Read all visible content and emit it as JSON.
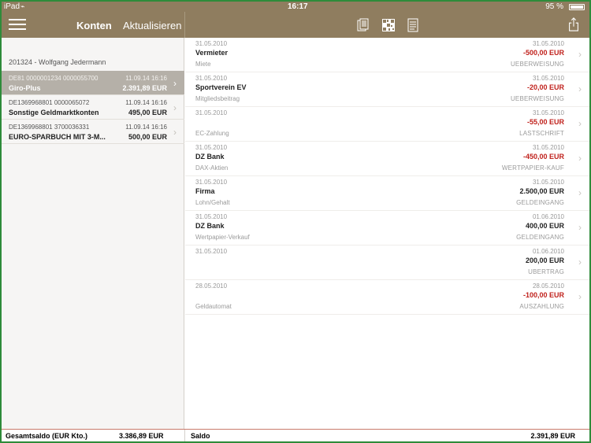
{
  "status": {
    "carrier": "iPad",
    "time": "16:17",
    "battery": "95 %"
  },
  "nav": {
    "title": "Konten",
    "refresh_label": "Aktualisieren",
    "icons": [
      "menu-icon",
      "documents-icon",
      "qr-grid-icon",
      "document-icon",
      "share-icon"
    ]
  },
  "customer": "201324 - Wolfgang Jedermann",
  "accounts": [
    {
      "iban": "DE81 0000001234 0000055700",
      "date": "11.09.14 16:16",
      "name": "Giro-Plus",
      "amount": "2.391,89 EUR"
    },
    {
      "iban": "DE1369968801 0000065072",
      "date": "11.09.14 16:16",
      "name": "Sonstige Geldmarktkonten",
      "amount": "495,00 EUR"
    },
    {
      "iban": "DE1369968801 3700036331",
      "date": "11.09.14 16:16",
      "name": "EURO-SPARBUCH MIT 3-M...",
      "amount": "500,00 EUR"
    }
  ],
  "transactions": [
    {
      "booking_date": "31.05.2010",
      "value_date": "31.05.2010",
      "payee": "Vermieter",
      "amount": "-500,00 EUR",
      "purpose": "Miete",
      "type": "UEBERWEISUNG",
      "negative": true
    },
    {
      "booking_date": "31.05.2010",
      "value_date": "31.05.2010",
      "payee": "Sportverein EV",
      "amount": "-20,00 EUR",
      "purpose": "Mitgliedsbeitrag",
      "type": "UEBERWEISUNG",
      "negative": true
    },
    {
      "booking_date": "31.05.2010",
      "value_date": "31.05.2010",
      "payee": "",
      "amount": "-55,00 EUR",
      "purpose": "EC-Zahlung",
      "type": "LASTSCHRIFT",
      "negative": true
    },
    {
      "booking_date": "31.05.2010",
      "value_date": "31.05.2010",
      "payee": "DZ Bank",
      "amount": "-450,00 EUR",
      "purpose": "DAX-Aktien",
      "type": "WERTPAPIER-KAUF",
      "negative": true
    },
    {
      "booking_date": "31.05.2010",
      "value_date": "31.05.2010",
      "payee": "Firma",
      "amount": "2.500,00 EUR",
      "purpose": "Lohn/Gehalt",
      "type": "GELDEINGANG",
      "negative": false
    },
    {
      "booking_date": "31.05.2010",
      "value_date": "01.06.2010",
      "payee": "DZ Bank",
      "amount": "400,00 EUR",
      "purpose": "Wertpapier-Verkauf",
      "type": "GELDEINGANG",
      "negative": false
    },
    {
      "booking_date": "31.05.2010",
      "value_date": "01.06.2010",
      "payee": "",
      "amount": "200,00 EUR",
      "purpose": "",
      "type": "UBERTRAG",
      "negative": false
    },
    {
      "booking_date": "28.05.2010",
      "value_date": "28.05.2010",
      "payee": "",
      "amount": "-100,00 EUR",
      "purpose": "Geldautomat",
      "type": "AUSZAHLUNG",
      "negative": true
    }
  ],
  "footer": {
    "total_label": "Gesamtsaldo (EUR Kto.)",
    "total_value": "3.386,89 EUR",
    "saldo_label": "Saldo",
    "saldo_value": "2.391,89 EUR"
  },
  "colors": {
    "bar": "#8f7d5f",
    "negative": "#c0211c",
    "selected": "#b5b0a8"
  }
}
